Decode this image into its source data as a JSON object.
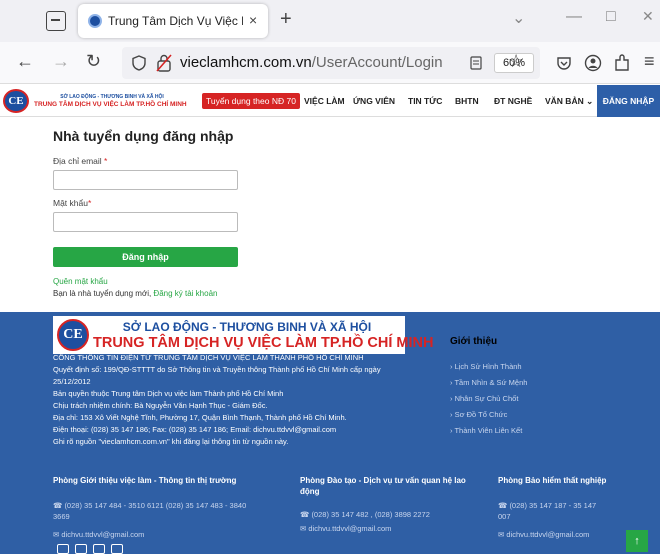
{
  "browser": {
    "tab_title": "Trung Tâm Dịch Vụ Việc Làm Hồ",
    "tab_close": "×",
    "new_tab": "+",
    "url_domain": "vieclamhcm.com.vn",
    "url_path": "/UserAccount/Login",
    "zoom": "60%",
    "icons": {
      "back": "←",
      "forward": "→",
      "reload": "↻",
      "star": "☆",
      "minimize": "—",
      "maximize": "□",
      "close": "✕",
      "menu": "≡",
      "chevron": "⌄"
    }
  },
  "site_header": {
    "logo_mark": "CE",
    "logo_line1": "SỞ LAO ĐỘNG - THƯƠNG BINH VÀ XÃ HỘI",
    "logo_line2": "TRUNG TÂM DỊCH VỤ VIỆC LÀM TP.HỒ CHÍ MINH",
    "badge": "Tuyển dụng theo NĐ 70",
    "menu": [
      "VIỆC LÀM",
      "ỨNG VIÊN",
      "TIN TỨC",
      "BHTN",
      "ĐT NGHỀ",
      "VĂN BẢN ⌄"
    ],
    "login_button": "ĐĂNG NHẬP",
    "brand_red": "#d62424",
    "brand_blue": "#1d4fa0",
    "accent_green": "#27a645"
  },
  "login": {
    "title": "Nhà tuyển dụng đăng nhập",
    "email_label": "Địa chỉ email",
    "password_label": "Mật khẩu",
    "required": "*",
    "submit": "Đăng nhập",
    "forgot": "Quên mật khẩu",
    "register_text": "Bạn là nhà tuyển dụng mới, ",
    "register_link": "Đăng ký tài khoản"
  },
  "footer": {
    "banner_line1": "SỞ LAO ĐỘNG - THƯƠNG BINH VÀ XÃ HỘI",
    "banner_line2": "TRUNG TÂM DỊCH VỤ VIỆC LÀM TP.HỒ CHÍ MINH",
    "info": [
      "CỔNG THÔNG TIN ĐIỆN TỬ TRUNG TÂM DỊCH VỤ VIỆC LÀM THÀNH PHỐ HỒ CHÍ MINH",
      "Quyết định số: 199/QĐ-STTTT do Sở Thông tin và Truyền thông Thành phố Hồ Chí Minh cấp ngày",
      "25/12/2012",
      "Bản quyền thuộc Trung tâm Dịch vụ việc làm Thành phố Hồ Chí Minh",
      "Chịu trách nhiệm chính: Bà Nguyễn Văn Hạnh Thục - Giám Đốc.",
      "Địa chỉ: 153 Xô Viết Nghệ Tĩnh, Phường 17, Quận Bình Thạnh, Thành phố Hồ Chí Minh.",
      "Điện thoại: (028) 35 147 186; Fax: (028) 35 147 186; Email: dichvu.ttdvvl@gmail.com",
      "Ghi rõ nguồn \"vieclamhcm.com.vn\" khi đăng lại thông tin từ nguồn này."
    ],
    "intro_title": "Giới thiệu",
    "intro_items": [
      "Lịch Sử Hình Thành",
      "Tầm Nhìn & Sứ Mệnh",
      "Nhân Sự Chủ Chốt",
      "Sơ Đồ Tổ Chức",
      "Thành Viên Liên Kết"
    ],
    "dept1_title": "Phòng Giới thiệu việc làm - Thông tin thị trường",
    "dept1_phone": "(028) 35 147 484 - 3510 6121 (028) 35 147 483 - 3840",
    "dept1_phone2": "3669",
    "dept1_email": "dichvu.ttdvvl@gmail.com",
    "dept2_title": "Phòng Đào tạo - Dịch vụ tư vấn quan hệ lao",
    "dept2_title2": "động",
    "dept2_phone": "(028) 35 147 482 , (028) 3898 2272",
    "dept2_email": "dichvu.ttdvvl@gmail.com",
    "dept3_title": "Phòng Bảo hiểm thất nghiệp",
    "dept3_phone": "(028) 35 147 187 - 35 147",
    "dept3_phone2": "007",
    "dept3_email": "dichvu.ttdvvl@gmail.com",
    "social": [
      "f",
      "in"
    ],
    "back_to_top": "↑"
  }
}
